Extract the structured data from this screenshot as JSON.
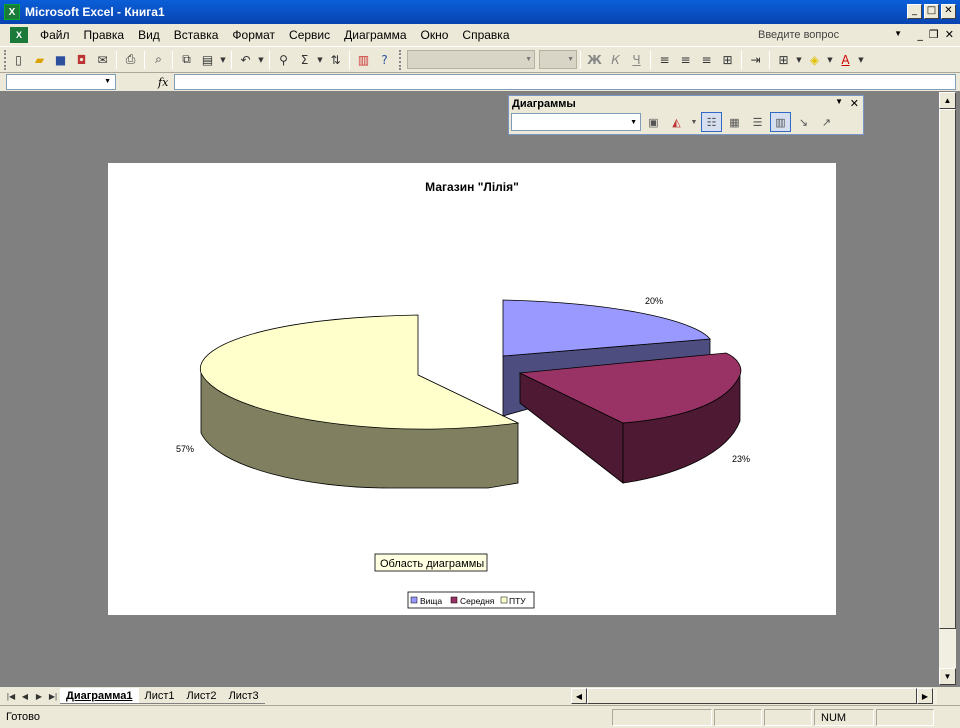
{
  "window": {
    "title": "Microsoft Excel - Книга1",
    "minimize": "_",
    "maximize": "□",
    "close": "✕"
  },
  "menu": {
    "items": [
      "Файл",
      "Правка",
      "Вид",
      "Вставка",
      "Формат",
      "Сервис",
      "Диаграмма",
      "Окно",
      "Справка"
    ],
    "ask_placeholder": "Введите вопрос"
  },
  "toolbar": {
    "buttons": [
      "new-icon",
      "open-icon",
      "save-icon",
      "permission-icon",
      "print-icon",
      "print-preview-icon",
      "spelling-icon",
      "copy-icon",
      "paste-icon",
      "undo-icon",
      "hyperlink-icon",
      "autosum-icon",
      "sort-icon",
      "chart-wizard-icon",
      "help-icon"
    ],
    "format_buttons": {
      "bold": "Ж",
      "italic": "К",
      "underline": "Ч"
    }
  },
  "formula_bar": {
    "fx_label": "fx",
    "name_value": "",
    "formula_value": ""
  },
  "chart_toolbar": {
    "title": "Диаграммы",
    "chart_object_value": ""
  },
  "chart_data": {
    "type": "pie",
    "title": "Магазин \"Лілія\"",
    "exploded": true,
    "three_d": true,
    "categories": [
      "Вища",
      "Середня",
      "ПТУ"
    ],
    "values": [
      20,
      23,
      57
    ],
    "value_labels": [
      "20%",
      "23%",
      "57%"
    ],
    "colors": [
      "#9999ff",
      "#993366",
      "#ffffcc"
    ],
    "legend_position": "bottom",
    "tooltip": "Область диаграммы"
  },
  "sheet_tabs": {
    "tabs": [
      "Диаграмма1",
      "Лист1",
      "Лист2",
      "Лист3"
    ],
    "active": 0
  },
  "status": {
    "text": "Готово",
    "num": "NUM"
  }
}
